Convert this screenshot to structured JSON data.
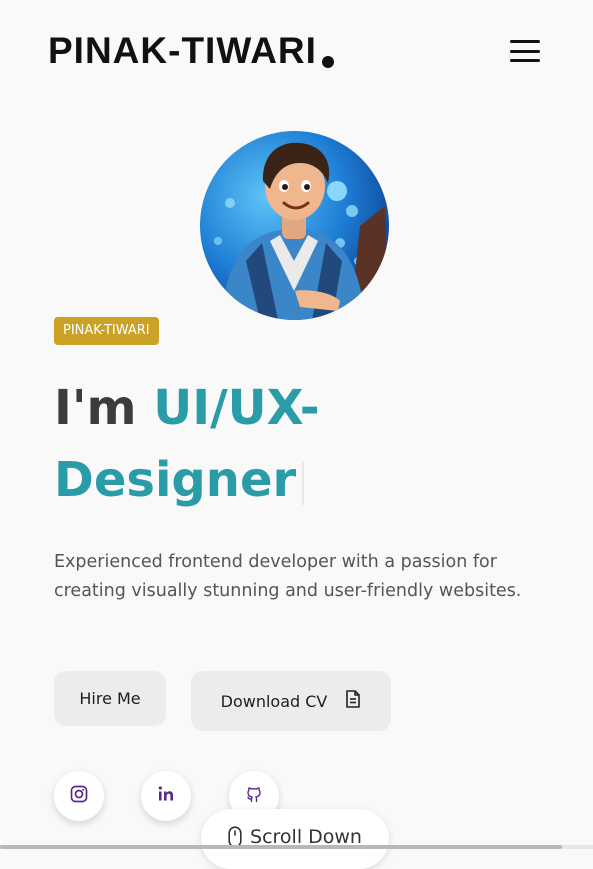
{
  "header": {
    "logo": "PINAK-TIWARI",
    "menu_icon": "hamburger-menu-icon"
  },
  "hero": {
    "badge": "PINAK-TIWARI",
    "headline_prefix": "I'm",
    "headline_role_line1": "UI/UX-",
    "headline_role_line2": "Designer",
    "description": "Experienced frontend developer with a passion for creating visually stunning and user-friendly websites."
  },
  "buttons": {
    "hire": "Hire Me",
    "download_cv": "Download CV",
    "download_icon": "document-icon"
  },
  "social": [
    {
      "icon": "instagram-icon"
    },
    {
      "icon": "linkedin-icon"
    },
    {
      "icon": "github-icon"
    }
  ],
  "scroll": {
    "label": "Scroll Down",
    "icon": "mouse-icon"
  },
  "colors": {
    "accent": "#2a9ca8",
    "badge": "#c9a227",
    "social_icon": "#5b2a86",
    "background": "#f9f9f9"
  }
}
